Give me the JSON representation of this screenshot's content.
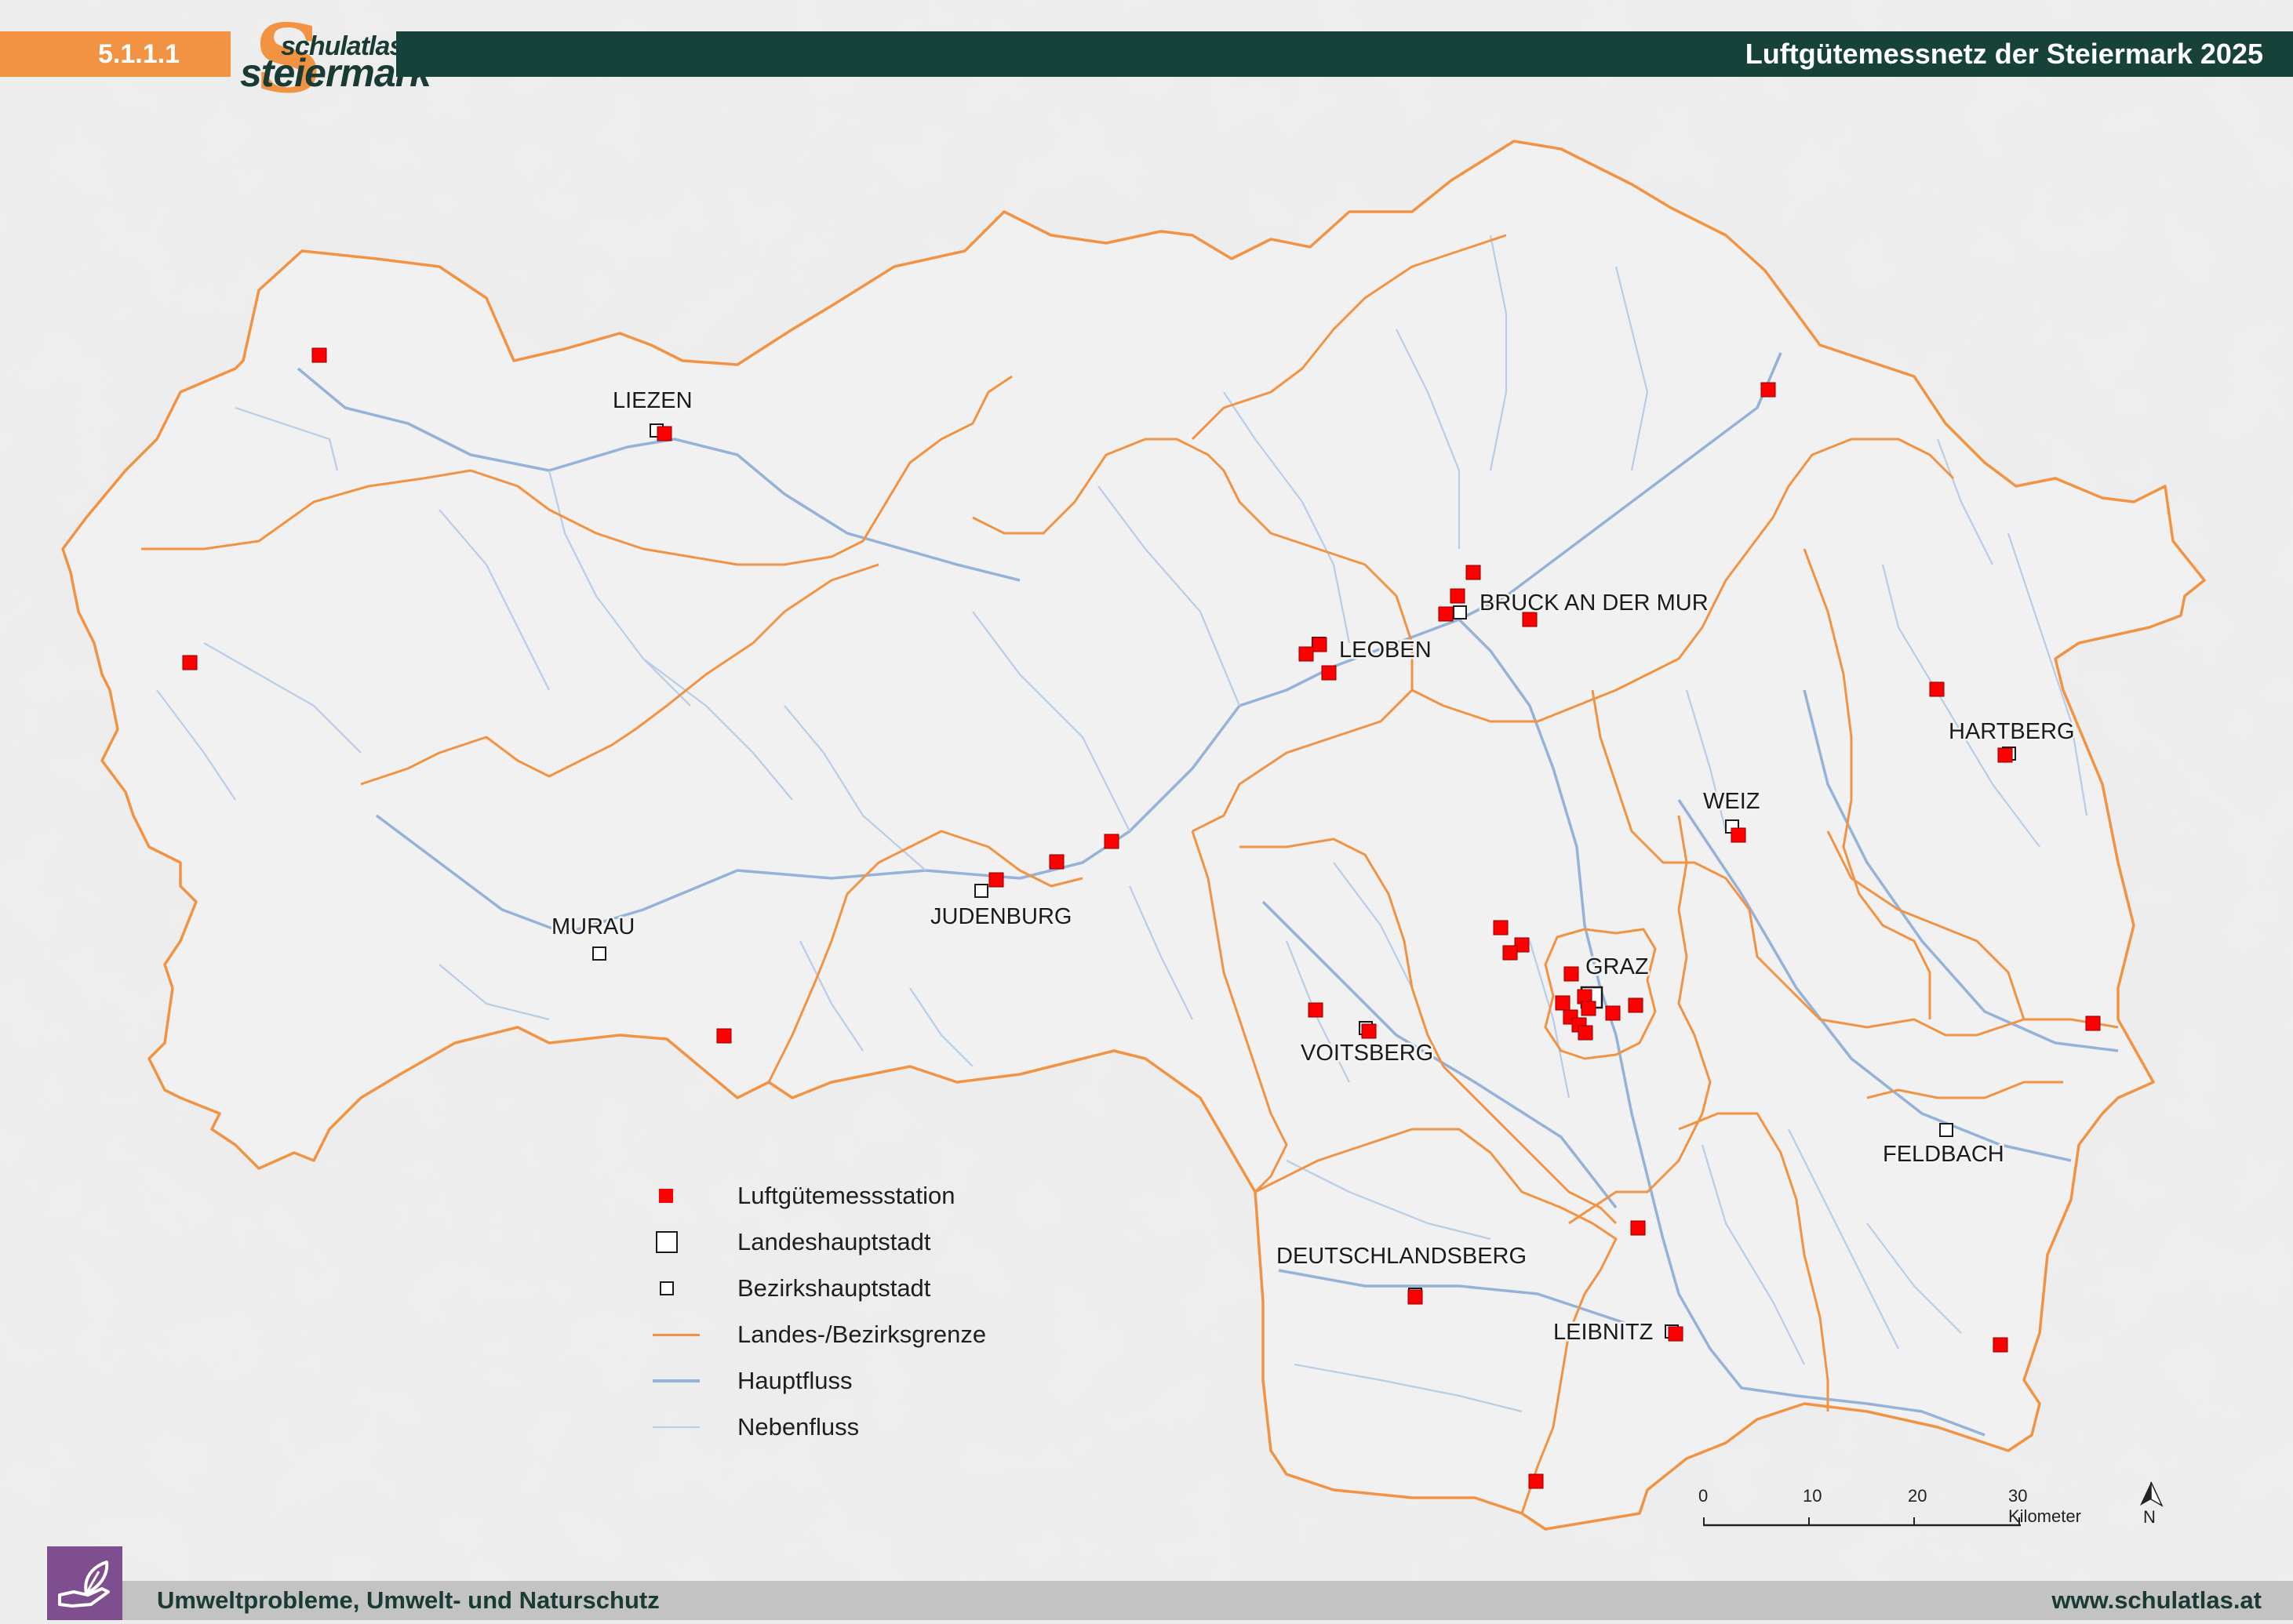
{
  "header": {
    "code": "5.1.1.1",
    "logo_small": "schulatlas",
    "logo_big": "steiermark",
    "title": "Luftgütemessnetz der Steiermark 2025"
  },
  "footer": {
    "topic": "Umweltprobleme, Umwelt- und Naturschutz",
    "url": "www.schulatlas.at"
  },
  "colors": {
    "station": "#ff0000",
    "border": "#f29343",
    "main_river": "#95b2d8",
    "side_river": "#b9cde6",
    "header_bar": "#16423a",
    "code_box": "#f29343"
  },
  "cities": {
    "liezen": "LIEZEN",
    "bruck": "BRUCK AN DER MUR",
    "leoben": "LEOBEN",
    "hartberg": "HARTBERG",
    "weiz": "WEIZ",
    "judenburg": "JUDENBURG",
    "murau": "MURAU",
    "graz": "GRAZ",
    "voitsberg": "VOITSBERG",
    "feldbach": "FELDBACH",
    "deutschlandsberg": "DEUTSCHLANDSBERG",
    "leibnitz": "LEIBNITZ"
  },
  "legend": {
    "station": "Luftgütemessstation",
    "capital": "Landeshauptstadt",
    "district_capital": "Bezirkshauptstadt",
    "border": "Landes-/Bezirksgrenze",
    "main_river": "Hauptfluss",
    "side_river": "Nebenfluss"
  },
  "scale": {
    "ticks": [
      "0",
      "10",
      "20",
      "30 Kilometer"
    ]
  },
  "north_label": "N"
}
